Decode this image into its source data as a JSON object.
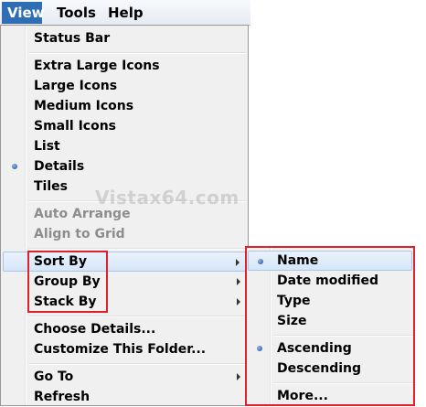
{
  "menubar": {
    "items": [
      {
        "label": "View"
      },
      {
        "label": "Tools"
      },
      {
        "label": "Help"
      }
    ]
  },
  "view_menu": {
    "status_bar": "Status Bar",
    "extra_large_icons": "Extra Large Icons",
    "large_icons": "Large Icons",
    "medium_icons": "Medium Icons",
    "small_icons": "Small Icons",
    "list": "List",
    "details": "Details",
    "tiles": "Tiles",
    "auto_arrange": "Auto Arrange",
    "align_to_grid": "Align to Grid",
    "sort_by": "Sort By",
    "group_by": "Group By",
    "stack_by": "Stack By",
    "choose_details": "Choose Details...",
    "customize_folder": "Customize This Folder...",
    "go_to": "Go To",
    "refresh": "Refresh"
  },
  "sort_submenu": {
    "name": "Name",
    "date_modified": "Date modified",
    "type": "Type",
    "size": "Size",
    "ascending": "Ascending",
    "descending": "Descending",
    "more": "More..."
  },
  "watermark": "Vistax64.com",
  "colors": {
    "menu_active": "#2f6db5",
    "highlight_box": "#e0202a",
    "menu_bg": "#f0f0f0",
    "disabled_text": "#8d8d8d"
  }
}
